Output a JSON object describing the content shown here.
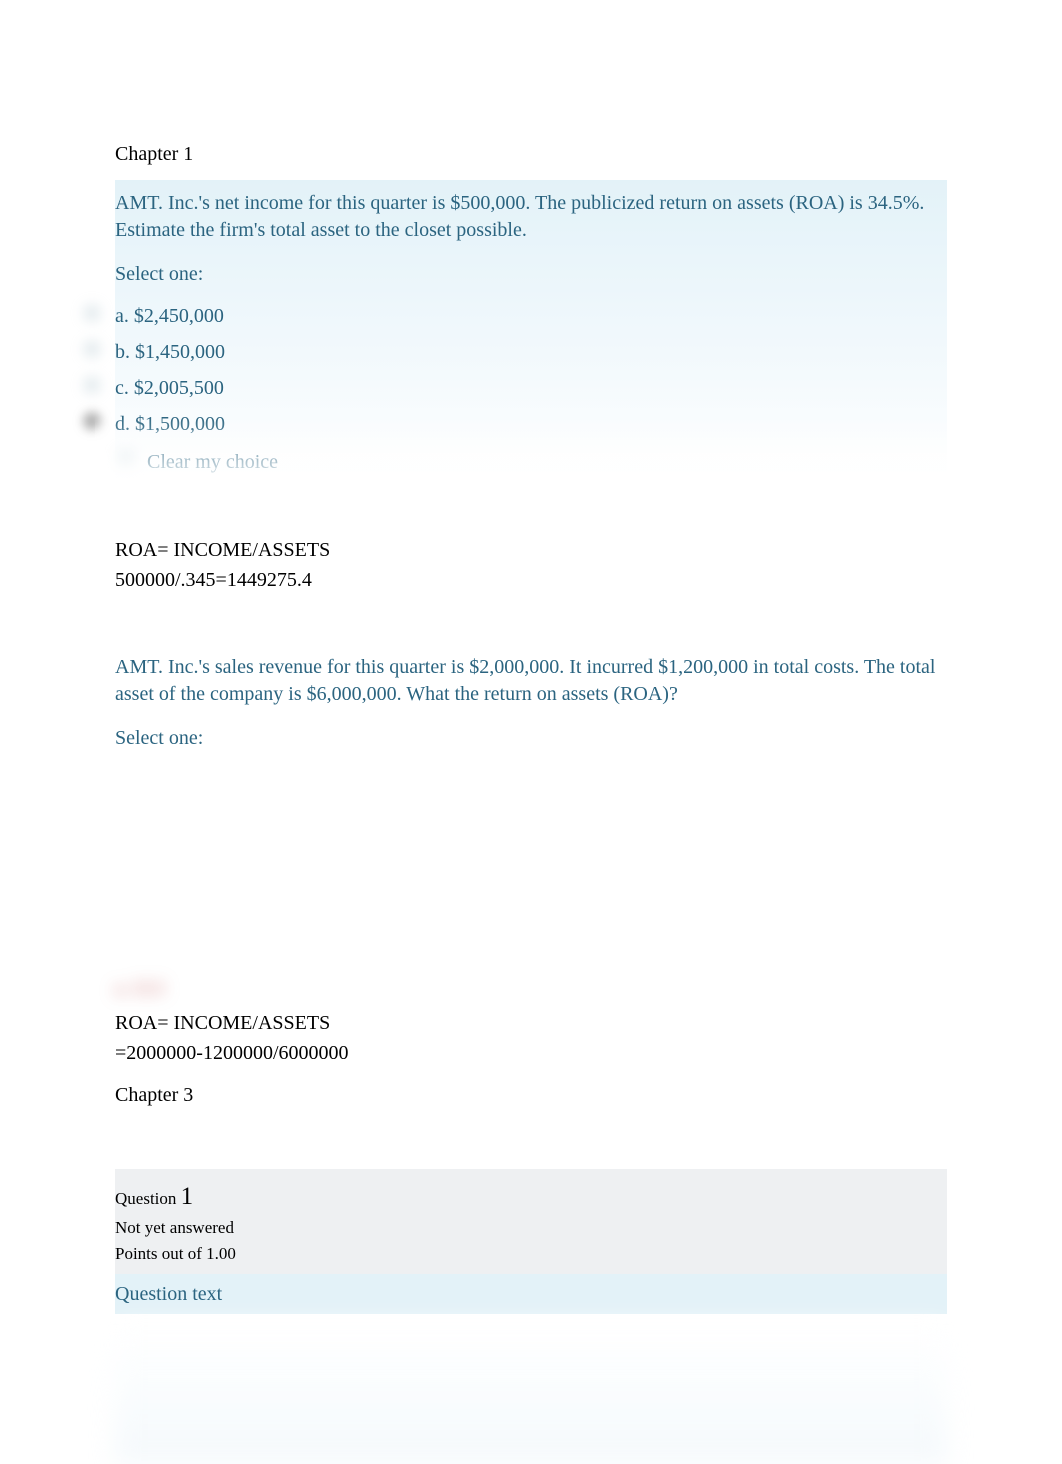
{
  "chapter1": {
    "heading": "Chapter 1"
  },
  "question1": {
    "text": "AMT. Inc.'s net income for this quarter is $500,000. The publicized return on assets (ROA) is 34.5%. Estimate the firm's total asset to the closet possible.",
    "select_one": "Select one:",
    "options": [
      {
        "label": "a. $2,450,000"
      },
      {
        "label": "b. $1,450,000"
      },
      {
        "label": "c. $2,005,500"
      },
      {
        "label": "d. $1,500,000"
      }
    ],
    "clear_choice": "Clear my choice"
  },
  "notes1": {
    "line1": "ROA= INCOME/ASSETS",
    "line2": "500000/.345=1449275.4"
  },
  "question2": {
    "text": "AMT. Inc.'s sales revenue for this quarter is $2,000,000. It incurred $1,200,000 in total costs. The total asset of the company is $6,000,000. What the return on assets (ROA)?",
    "select_one": "Select one:"
  },
  "blurred_answer": "a. 13.3",
  "notes2": {
    "line1": "ROA= INCOME/ASSETS",
    "line2": "=2000000-1200000/6000000"
  },
  "chapter3": {
    "heading": "Chapter 3"
  },
  "question_info": {
    "label": "Question ",
    "number": "1",
    "status": "Not yet answered",
    "points": "Points out of 1.00",
    "text_header": "Question text"
  }
}
